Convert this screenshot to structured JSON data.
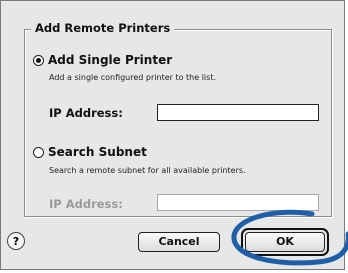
{
  "dialog": {
    "group_title": "Add Remote Printers",
    "single": {
      "label": "Add Single Printer",
      "description": "Add a single configured printer to the list.",
      "ip_label": "IP Address:",
      "ip_value": "",
      "selected": true
    },
    "subnet": {
      "label": "Search Subnet",
      "description": "Search a remote subnet for all available printers.",
      "ip_label": "IP Address:",
      "ip_value": "",
      "selected": false
    },
    "help_label": "?",
    "cancel_label": "Cancel",
    "ok_label": "OK"
  },
  "annotation": {
    "color": "#1f5fa8",
    "shape": "ellipse"
  }
}
